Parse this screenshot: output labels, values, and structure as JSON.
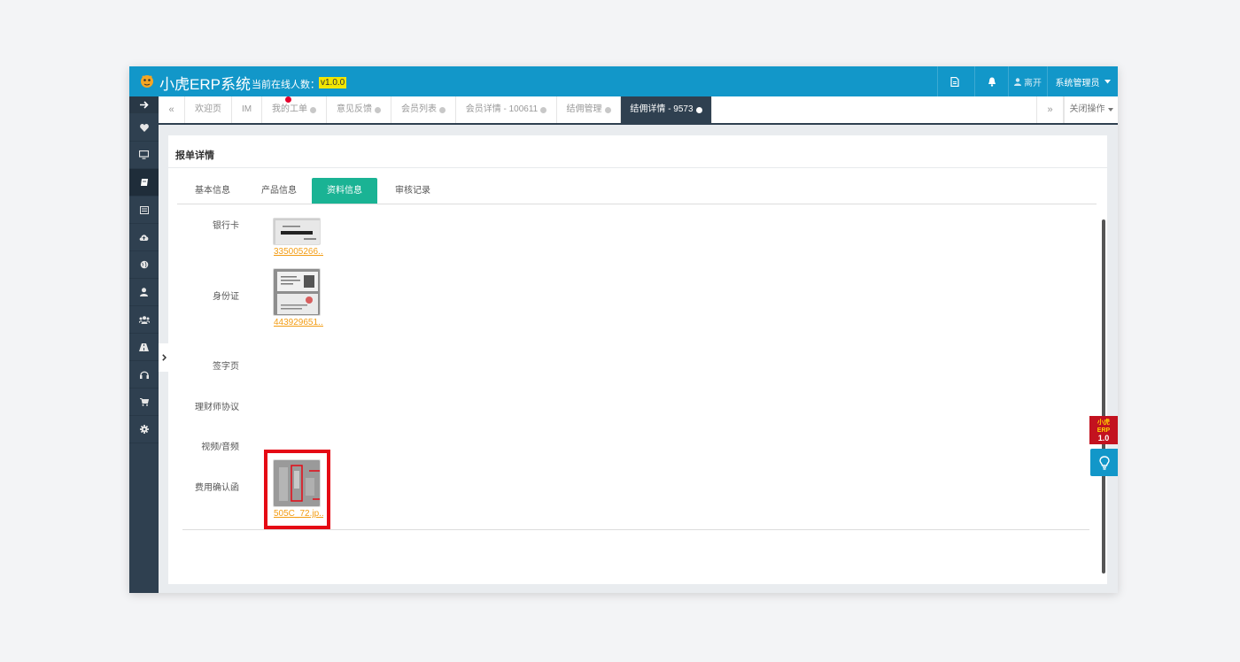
{
  "header": {
    "app_title": "小虎ERP系统",
    "online_label": "当前在线人数：1",
    "version": "v1.0.0",
    "leave_label": "离开",
    "user_label": "系统管理员"
  },
  "tabs": {
    "prev": "«",
    "next": "»",
    "close_ops": "关闭操作",
    "items": [
      {
        "label": "欢迎页"
      },
      {
        "label": "IM"
      },
      {
        "label": "我的工单"
      },
      {
        "label": "意见反馈"
      },
      {
        "label": "会员列表"
      },
      {
        "label": "会员详情 - 100611"
      },
      {
        "label": "结佣管理"
      },
      {
        "label": "结佣详情 - 9573"
      }
    ]
  },
  "panel": {
    "title": "报单详情",
    "sub_tabs": [
      {
        "label": "基本信息"
      },
      {
        "label": "产品信息"
      },
      {
        "label": "资料信息"
      },
      {
        "label": "审核记录"
      }
    ],
    "fields": [
      {
        "label": "银行卡",
        "file": "335005266..."
      },
      {
        "label": "身份证",
        "file": "443929651..."
      },
      {
        "label": "签字页"
      },
      {
        "label": "理财师协议"
      },
      {
        "label": "视频/音频"
      },
      {
        "label": "费用确认函",
        "file": "505C_72.jp..."
      }
    ]
  },
  "promo": {
    "text1": "小虎",
    "text2": "ERP",
    "text3": "1.0"
  },
  "colors": {
    "header": "#1297c9",
    "sidebar": "#2f4050",
    "active_sub_tab": "#1ab394",
    "link": "#f39c12",
    "highlight": "#e50914"
  }
}
